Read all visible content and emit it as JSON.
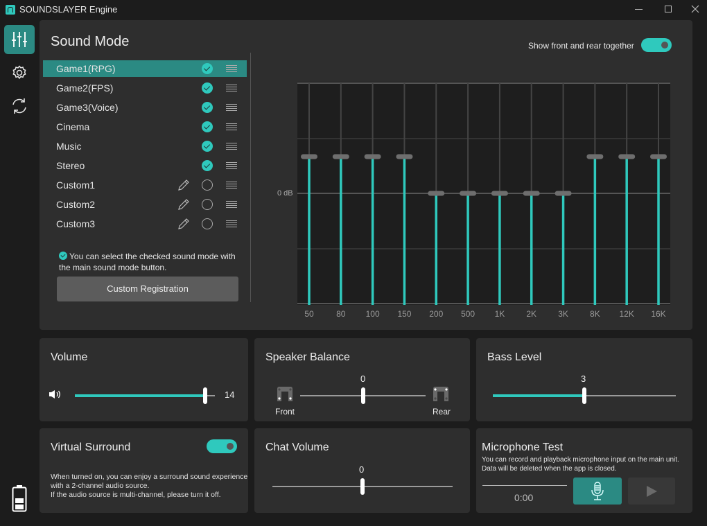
{
  "window": {
    "title": "SOUNDSLAYER Engine",
    "controls": [
      "minimize",
      "maximize",
      "close"
    ]
  },
  "sidebar": {
    "items": [
      {
        "name": "equalizer",
        "icon": "sliders-icon",
        "active": true
      },
      {
        "name": "settings",
        "icon": "gear-icon",
        "active": false
      },
      {
        "name": "sync",
        "icon": "refresh-icon",
        "active": false
      }
    ],
    "battery": {
      "icon": "battery-icon",
      "level_fraction": 0.5
    }
  },
  "sound_mode": {
    "title": "Sound Mode",
    "modes": [
      {
        "label": "Game1(RPG)",
        "checked": true,
        "editable": false,
        "selected": true
      },
      {
        "label": "Game2(FPS)",
        "checked": true,
        "editable": false,
        "selected": false
      },
      {
        "label": "Game3(Voice)",
        "checked": true,
        "editable": false,
        "selected": false
      },
      {
        "label": "Cinema",
        "checked": true,
        "editable": false,
        "selected": false
      },
      {
        "label": "Music",
        "checked": true,
        "editable": false,
        "selected": false
      },
      {
        "label": "Stereo",
        "checked": true,
        "editable": false,
        "selected": false
      },
      {
        "label": "Custom1",
        "checked": false,
        "editable": true,
        "selected": false
      },
      {
        "label": "Custom2",
        "checked": false,
        "editable": true,
        "selected": false
      },
      {
        "label": "Custom3",
        "checked": false,
        "editable": true,
        "selected": false
      }
    ],
    "hint": "You can select the checked sound mode with the main sound mode button.",
    "custom_registration_label": "Custom Registration",
    "show_front_rear_label": "Show front and rear together",
    "show_front_rear_on": true
  },
  "equalizer": {
    "zero_label": "0 dB",
    "range_steps": [
      -3,
      3
    ],
    "bands": [
      {
        "label": "50",
        "level": 1
      },
      {
        "label": "80",
        "level": 1
      },
      {
        "label": "100",
        "level": 1
      },
      {
        "label": "150",
        "level": 1
      },
      {
        "label": "200",
        "level": 0
      },
      {
        "label": "500",
        "level": 0
      },
      {
        "label": "1K",
        "level": 0
      },
      {
        "label": "2K",
        "level": 0
      },
      {
        "label": "3K",
        "level": 0
      },
      {
        "label": "8K",
        "level": 1
      },
      {
        "label": "12K",
        "level": 1
      },
      {
        "label": "16K",
        "level": 1
      }
    ]
  },
  "volume": {
    "title": "Volume",
    "value": "14",
    "fraction": 0.93,
    "icon": "speaker-icon"
  },
  "speaker_balance": {
    "title": "Speaker Balance",
    "value": "0",
    "fraction": 0.5,
    "front_label": "Front",
    "rear_label": "Rear"
  },
  "bass_level": {
    "title": "Bass Level",
    "value": "3",
    "fraction": 0.5
  },
  "virtual_surround": {
    "title": "Virtual Surround",
    "on": true,
    "description_lines": [
      "When turned on, you can enjoy a surround sound experience",
      "with a 2-channel audio source.",
      "If the audio source is multi-channel, please turn it off."
    ]
  },
  "chat_volume": {
    "title": "Chat Volume",
    "value": "0",
    "fraction": 0.5
  },
  "mic_test": {
    "title": "Microphone Test",
    "description_lines": [
      "You can record and playback microphone input on the main unit.",
      "Data will be deleted when the app is closed."
    ],
    "time": "0:00"
  },
  "colors": {
    "accent": "#2fc9bd",
    "accent_dark": "#2b8a83",
    "panel": "#2e2e2e",
    "background": "#1c1c1c"
  }
}
